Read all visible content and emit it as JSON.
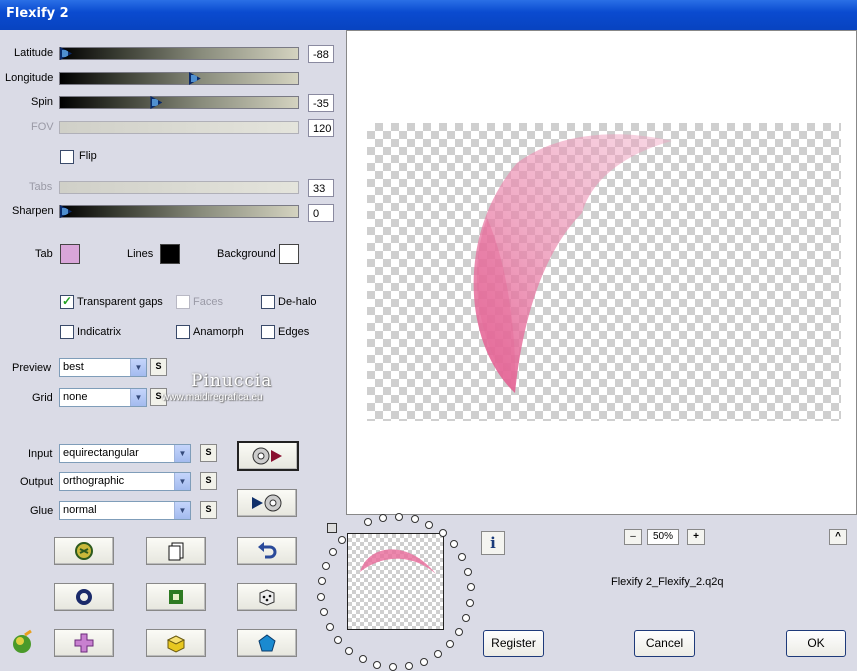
{
  "window": {
    "title": "Flexify 2"
  },
  "sliders": {
    "latitude": {
      "label": "Latitude",
      "value": "-88",
      "level": 0.0
    },
    "longitude": {
      "label": "Longitude",
      "value": "",
      "level": 0.57
    },
    "spin": {
      "label": "Spin",
      "value": "-35",
      "level": 0.4
    },
    "fov": {
      "label": "FOV",
      "value": "120",
      "level": null
    },
    "tabs": {
      "label": "Tabs",
      "value": "33",
      "level": null
    },
    "sharpen": {
      "label": "Sharpen",
      "value": "0",
      "level": 0.0
    }
  },
  "flip": {
    "label": "Flip",
    "checked": false
  },
  "colors": {
    "tab": {
      "label": "Tab",
      "value": "#d9a6d9"
    },
    "lines": {
      "label": "Lines",
      "value": "#000000"
    },
    "background": {
      "label": "Background",
      "value": "#ffffff"
    }
  },
  "options": {
    "transparent_gaps": {
      "label": "Transparent gaps",
      "checked": true
    },
    "faces": {
      "label": "Faces",
      "checked": false
    },
    "de_halo": {
      "label": "De-halo",
      "checked": false
    },
    "indicatrix": {
      "label": "Indicatrix",
      "checked": false
    },
    "anamorph": {
      "label": "Anamorph",
      "checked": false
    },
    "edges": {
      "label": "Edges",
      "checked": false
    }
  },
  "preview_select": {
    "label": "Preview",
    "value": "best"
  },
  "grid_select": {
    "label": "Grid",
    "value": "none"
  },
  "input_select": {
    "label": "Input",
    "value": "equirectangular"
  },
  "output_select": {
    "label": "Output",
    "value": "orthographic"
  },
  "glue_select": {
    "label": "Glue",
    "value": "normal"
  },
  "s_label": "S",
  "watermark": {
    "name": "Pinuccia",
    "site": "www.maidiregrafica.eu"
  },
  "zoom": {
    "minus": "–",
    "value": "50%",
    "plus": "+"
  },
  "preset_name": "Flexify 2_Flexify_2.q2q",
  "buttons": {
    "register": "Register",
    "cancel": "Cancel",
    "ok": "OK",
    "caret": "^",
    "info": "i"
  },
  "icons": [
    "globe-to-map-icon",
    "map-to-globe-icon",
    "randomize-icon",
    "new-page-icon",
    "undo-icon",
    "ring-icon",
    "square-icon",
    "dice-icon",
    "plus-shape-icon",
    "cube-icon",
    "pentagon-icon"
  ]
}
